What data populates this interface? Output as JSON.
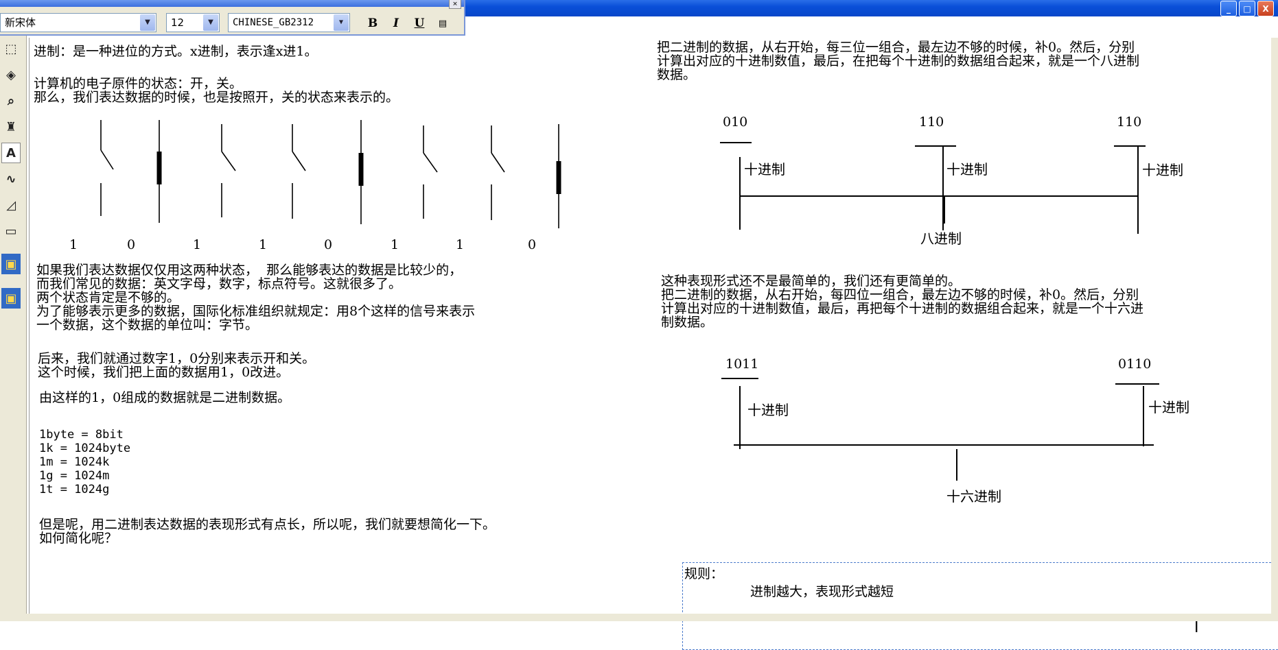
{
  "window": {
    "min_label": "_",
    "max_label": "□",
    "close_label": "X"
  },
  "format_toolbar": {
    "font_name": "新宋体",
    "font_size": "12",
    "script": "CHINESE_GB2312",
    "bold_label": "B",
    "italic_label": "I",
    "underline_label": "U"
  },
  "left": {
    "p1": "进制：是一种进位的方式。x进制，表示逢x进1。",
    "p2": "计算机的电子原件的状态：开，关。\n那么，我们表达数据的时候，也是按照开，关的状态来表示的。",
    "bits": [
      "1",
      "0",
      "1",
      "1",
      "0",
      "1",
      "1",
      "0"
    ],
    "p3": "如果我们表达数据仅仅用这两种状态，  那么能够表达的数据是比较少的，\n而我们常见的数据：英文字母，数字，标点符号。这就很多了。\n两个状态肯定是不够的。\n为了能够表示更多的数据，国际化标准组织就规定：用8个这样的信号来表示\n一个数据，这个数据的单位叫：字节。",
    "p4": "后来，我们就通过数字1，0分别来表示开和关。\n这个时候，我们把上面的数据用1，0改进。",
    "p5": "由这样的1，0组成的数据就是二进制数据。",
    "units": "1byte = 8bit\n1k = 1024byte\n1m = 1024k\n1g = 1024m\n1t = 1024g",
    "p6": "但是呢，用二进制表达数据的表现形式有点长，所以呢，我们就要想简化一下。\n如何简化呢？"
  },
  "right": {
    "octal_text": "把二进制的数据，从右开始，每三位一组合，最左边不够的时候，补0。然后，分别\n计算出对应的十进制数值，最后，在把每个十进制的数据组合起来，就是一个八进制\n数据。",
    "octal_groups": [
      "010",
      "110",
      "110"
    ],
    "decimal_label": "十进制",
    "octal_label": "八进制",
    "hex_text": "这种表现形式还不是最简单的，我们还有更简单的。\n把二进制的数据，从右开始，每四位一组合，最左边不够的时候，补0。然后，分别\n计算出对应的十进制数值，最后，再把每个十进制的数据组合起来，就是一个十六进\n制数据。",
    "hex_groups": [
      "1011",
      "0110"
    ],
    "hex_label": "十六进制",
    "rule_title": "规则：",
    "rule_text": "进制越大，表现形式越短"
  }
}
